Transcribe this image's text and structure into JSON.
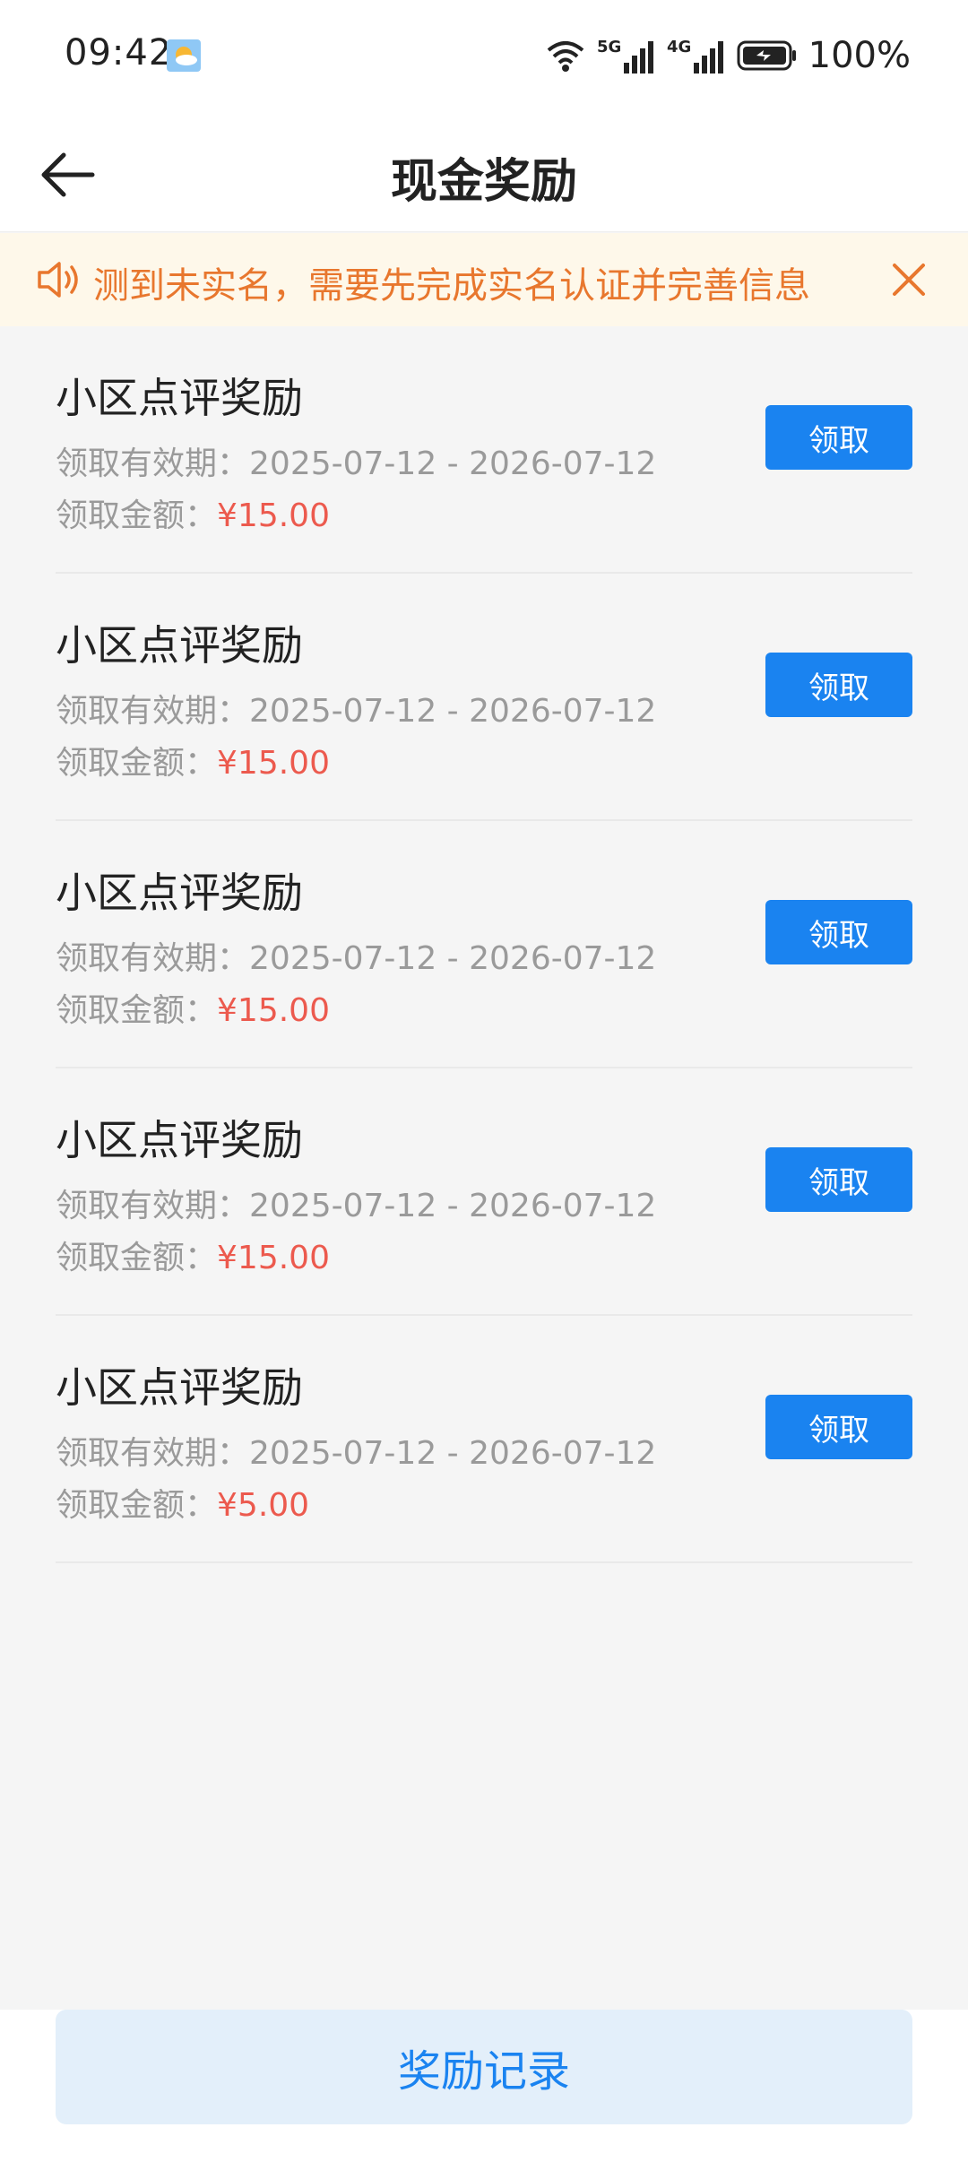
{
  "status_bar": {
    "time": "09:42",
    "network_5g": "5G",
    "network_4g": "4G",
    "battery": "100%",
    "icons": [
      "weather-icon",
      "wifi-icon",
      "signal-5g-icon",
      "signal-4g-icon",
      "battery-icon"
    ]
  },
  "header": {
    "title": "现金奖励",
    "back_icon": "arrow-left-icon"
  },
  "notice": {
    "text": "测到未实名，需要先完成实名认证并完善信息",
    "icon": "speaker-icon",
    "close_icon": "close-icon"
  },
  "rewards": [
    {
      "title": "小区点评奖励",
      "validity_label": "领取有效期：",
      "validity": "2025-07-12 - 2026-07-12",
      "amount_label": "领取金额：",
      "amount": "¥15.00",
      "button": "领取"
    },
    {
      "title": "小区点评奖励",
      "validity_label": "领取有效期：",
      "validity": "2025-07-12 - 2026-07-12",
      "amount_label": "领取金额：",
      "amount": "¥15.00",
      "button": "领取"
    },
    {
      "title": "小区点评奖励",
      "validity_label": "领取有效期：",
      "validity": "2025-07-12 - 2026-07-12",
      "amount_label": "领取金额：",
      "amount": "¥15.00",
      "button": "领取"
    },
    {
      "title": "小区点评奖励",
      "validity_label": "领取有效期：",
      "validity": "2025-07-12 - 2026-07-12",
      "amount_label": "领取金额：",
      "amount": "¥15.00",
      "button": "领取"
    },
    {
      "title": "小区点评奖励",
      "validity_label": "领取有效期：",
      "validity": "2025-07-12 - 2026-07-12",
      "amount_label": "领取金额：",
      "amount": "¥5.00",
      "button": "领取"
    }
  ],
  "footer": {
    "history_button": "奖励记录"
  },
  "colors": {
    "accent": "#1a83f0",
    "amount": "#ec5a4e",
    "notice_text": "#e8772e",
    "notice_bg": "#fef8ea"
  }
}
